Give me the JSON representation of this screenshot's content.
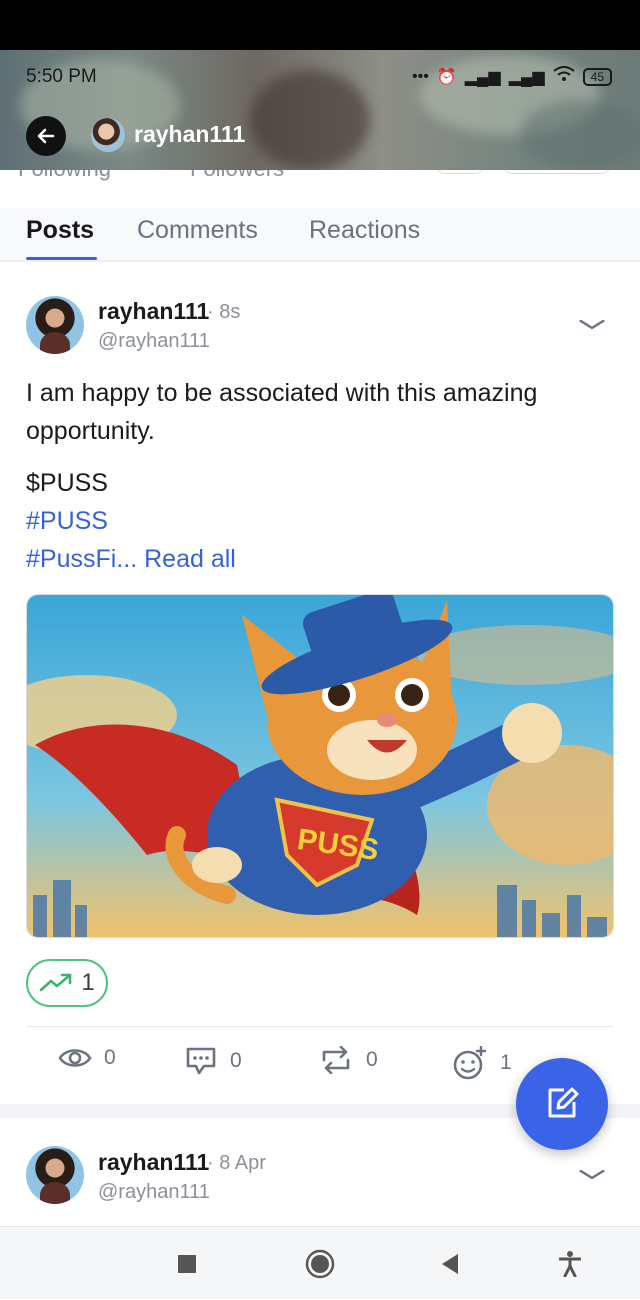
{
  "status_bar": {
    "time": "5:50 PM",
    "battery": "45"
  },
  "header": {
    "username": "rayhan111"
  },
  "profile_peek": {
    "following_label": "Following",
    "followers_label": "Followers"
  },
  "tabs": [
    {
      "label": "Posts",
      "active": true
    },
    {
      "label": "Comments",
      "active": false
    },
    {
      "label": "Reactions",
      "active": false
    }
  ],
  "posts": [
    {
      "author": "rayhan111",
      "time": "· 8s",
      "handle": "@rayhan111",
      "text": "I am happy to be associated with this amazing opportunity.",
      "ticker": "$PUSS",
      "hashtags": [
        "#PUSS"
      ],
      "truncated_tag": "#PussFi...",
      "read_more": "Read all",
      "image_caption": "PUSS",
      "boost_count": "1",
      "actions": {
        "views": "0",
        "comments": "0",
        "reposts": "0",
        "reactions": "1"
      }
    },
    {
      "author": "rayhan111",
      "time": "· 8 Apr",
      "handle": "@rayhan111"
    }
  ],
  "colors": {
    "accent": "#3a63d8",
    "boost_green": "#4fc27f",
    "fab": "#3a63e8"
  }
}
